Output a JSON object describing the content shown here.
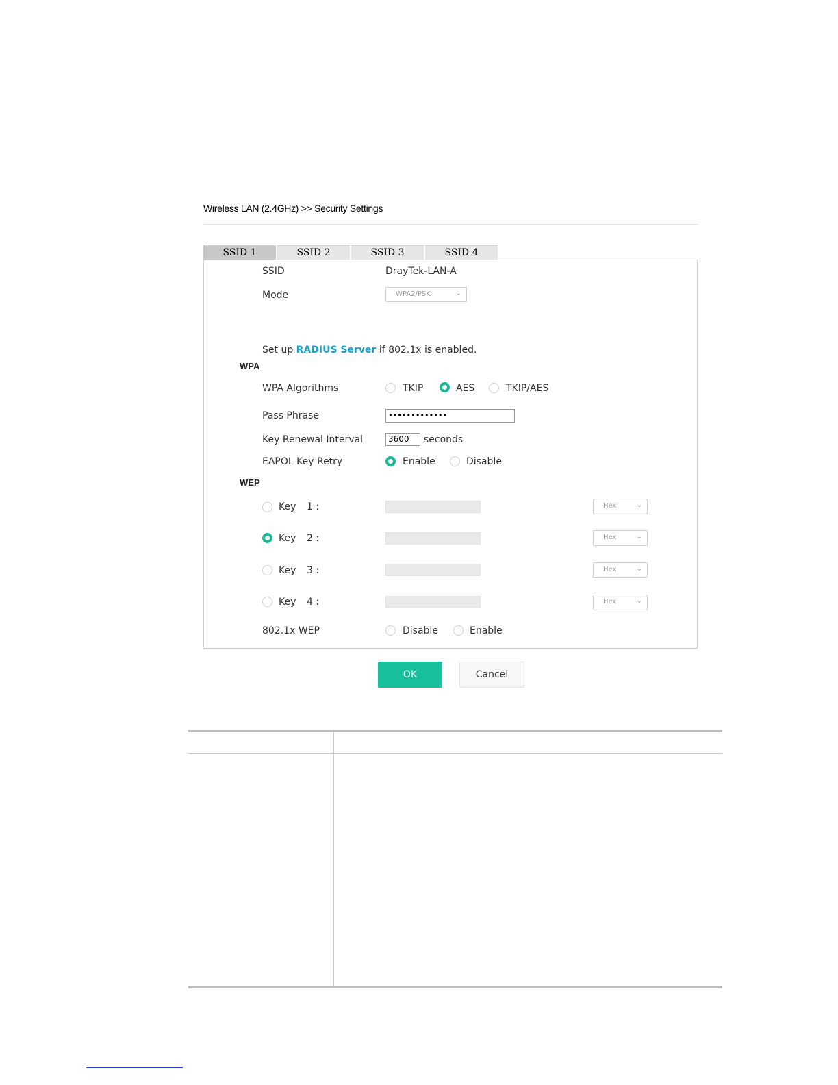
{
  "page": {
    "title": "Wireless LAN (2.4GHz) >> Security Settings"
  },
  "tabs": [
    {
      "label": "SSID 1",
      "active": true
    },
    {
      "label": "SSID 2",
      "active": false
    },
    {
      "label": "SSID 3",
      "active": false
    },
    {
      "label": "SSID 4",
      "active": false
    }
  ],
  "form": {
    "ssid_label": "SSID",
    "ssid_value": "DrayTek-LAN-A",
    "mode_label": "Mode",
    "mode_value": "WPA2/PSK",
    "radius_prefix": "Set up",
    "radius_link": "RADIUS Server",
    "radius_suffix": "if 802.1x is enabled.",
    "wpa_section": "WPA",
    "wpa_algorithms_label": "WPA Algorithms",
    "wpa_algorithms_options": [
      "TKIP",
      "AES",
      "TKIP/AES"
    ],
    "wpa_algorithms_selected": "AES",
    "pass_phrase_label": "Pass Phrase",
    "pass_phrase_value": "•••••••••••••",
    "key_renewal_label": "Key Renewal Interval",
    "key_renewal_value": "3600",
    "key_renewal_unit": "seconds",
    "eapol_label": "EAPOL Key Retry",
    "eapol_options": [
      "Enable",
      "Disable"
    ],
    "eapol_selected": "Enable",
    "wep_section": "WEP",
    "wep_keys": [
      {
        "label": "Key",
        "index": "1 :",
        "format": "Hex",
        "selected": false
      },
      {
        "label": "Key",
        "index": "2 :",
        "format": "Hex",
        "selected": true
      },
      {
        "label": "Key",
        "index": "3 :",
        "format": "Hex",
        "selected": false
      },
      {
        "label": "Key",
        "index": "4 :",
        "format": "Hex",
        "selected": false
      }
    ],
    "wep_8021x_label": "802.1x WEP",
    "wep_8021x_options": [
      "Disable",
      "Enable"
    ],
    "wep_8021x_selected": "none"
  },
  "buttons": {
    "ok": "OK",
    "cancel": "Cancel"
  },
  "colors": {
    "accent": "#17b894",
    "link": "#1aa3cf",
    "ok_button": "#17bf9a"
  },
  "icons": {
    "select_arrow": "chevron-down-icon"
  }
}
